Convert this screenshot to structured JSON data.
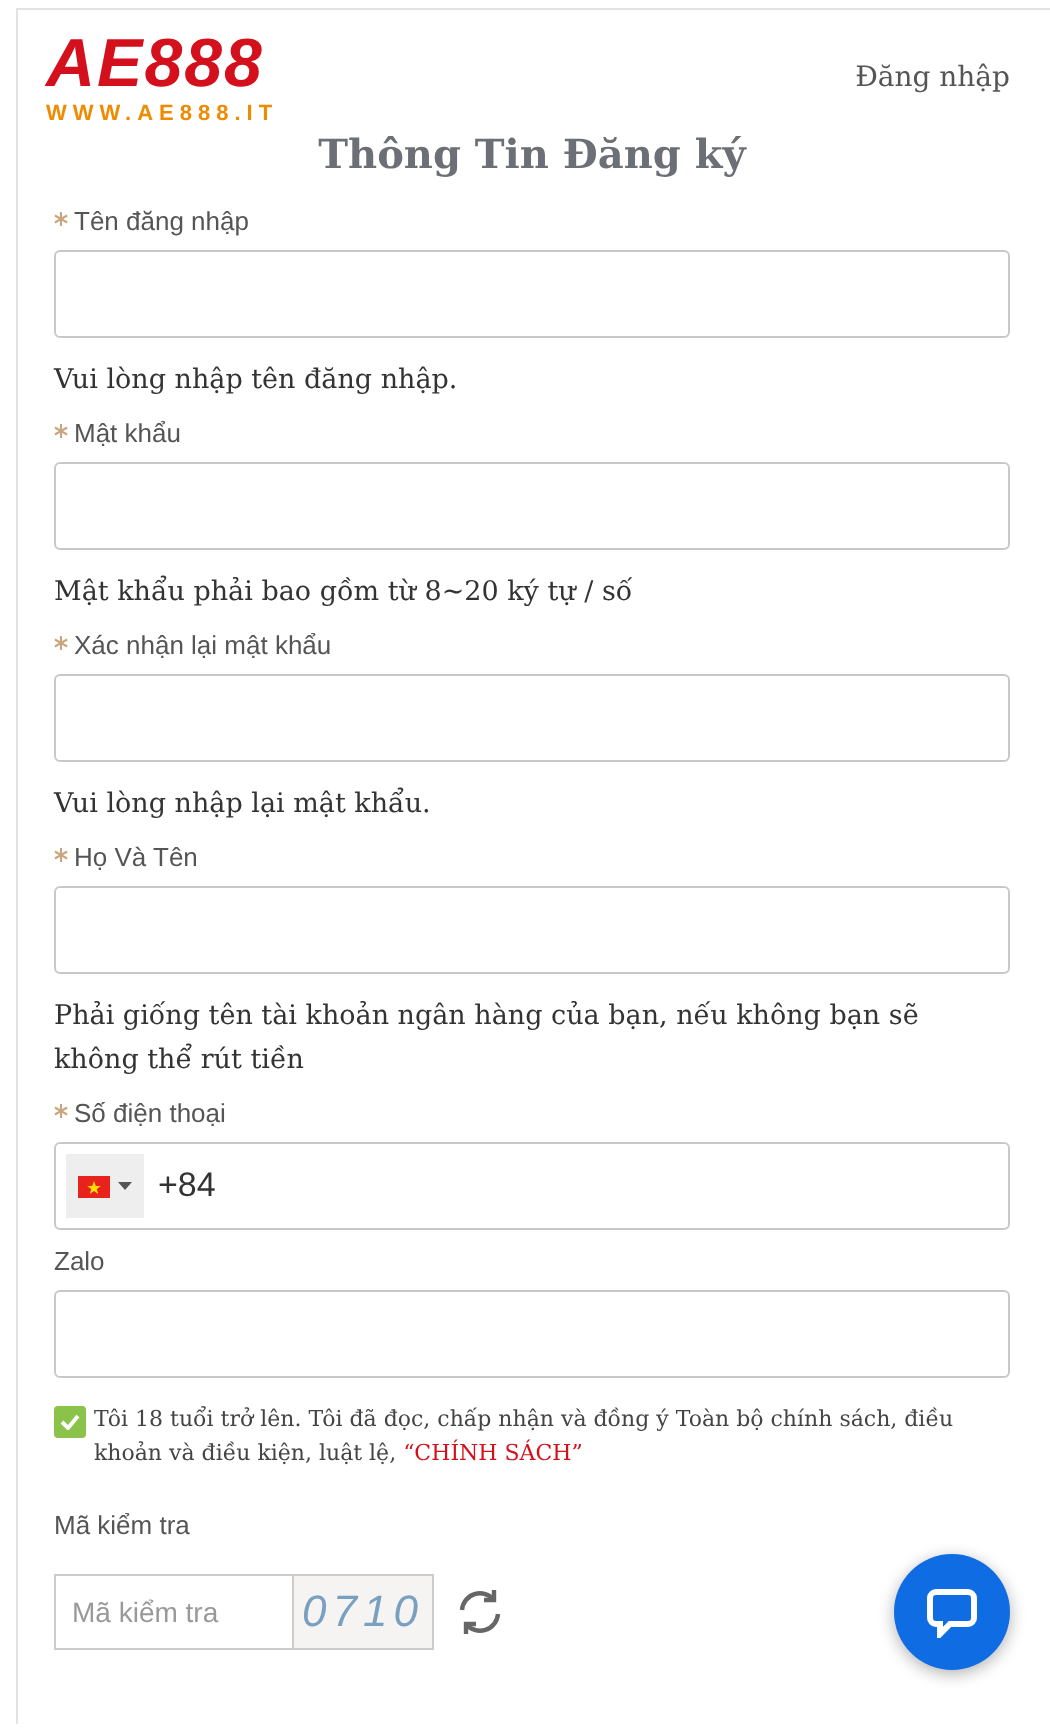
{
  "header": {
    "logo": {
      "brand": "AE888",
      "url": "WWW.AE888.IT"
    },
    "login_link": "Đăng nhập"
  },
  "title": "Thông Tin Đăng ký",
  "fields": [
    {
      "kind": "text",
      "label": "Tên đăng nhập",
      "required": true,
      "hint": "Vui lòng nhập tên đăng nhập."
    },
    {
      "kind": "text",
      "label": "Mật khẩu",
      "required": true,
      "hint": "Mật khẩu phải bao gồm từ 8~20 ký tự / số"
    },
    {
      "kind": "text",
      "label": "Xác nhận lại mật khẩu",
      "required": true,
      "hint": "Vui lòng nhập lại mật khẩu."
    },
    {
      "kind": "text",
      "label": "Họ Và Tên",
      "required": true,
      "hint": "Phải giống tên tài khoản ngân hàng của bạn, nếu không bạn sẽ không thể rút tiền"
    },
    {
      "kind": "phone",
      "label": "Số điện thoại",
      "required": true,
      "value": "+84"
    },
    {
      "kind": "text",
      "label": "Zalo",
      "required": false
    }
  ],
  "agreement": {
    "checked": true,
    "text": "Tôi 18 tuổi trở lên. Tôi đã đọc, chấp nhận và đồng ý Toàn bộ chính sách, điều khoản và điều kiện, luật lệ,",
    "link": "“CHÍNH SÁCH”"
  },
  "captcha": {
    "label": "Mã kiểm tra",
    "placeholder": "Mã kiểm tra",
    "code": "0710"
  }
}
